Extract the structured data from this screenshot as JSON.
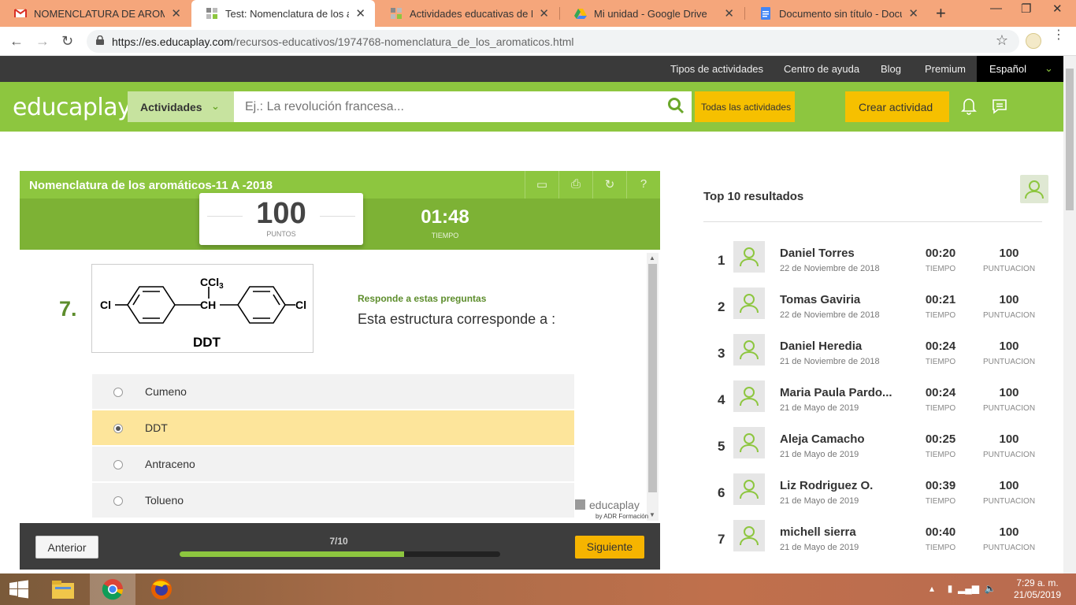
{
  "browser": {
    "tabs": [
      {
        "title": "NOMENCLATURA DE AROMATICOS",
        "icon": "gmail-icon"
      },
      {
        "title": "Test: Nomenclatura de los aromáticos",
        "icon": "educaplay-icon"
      },
      {
        "title": "Actividades educativas de Maria",
        "icon": "educaplay-icon"
      },
      {
        "title": "Mi unidad - Google Drive",
        "icon": "drive-icon"
      },
      {
        "title": "Documento sin título - Documentos",
        "icon": "docs-icon"
      }
    ],
    "url_host": "https://es.educaplay.com",
    "url_path": "/recursos-educativos/1974768-nomenclatura_de_los_aromaticos.html"
  },
  "topbar": {
    "links": [
      "Tipos de actividades",
      "Centro de ayuda",
      "Blog",
      "Premium"
    ],
    "language": "Español"
  },
  "header": {
    "logo": "educaplay",
    "activities_label": "Actividades",
    "search_placeholder": "Ej.: La revolución francesa...",
    "all_activities": "Todas las actividades",
    "create_activity": "Crear actividad"
  },
  "quiz": {
    "title": "Nomenclatura de los aromáticos-11 A -2018",
    "score": "100",
    "score_label": "PUNTOS",
    "time": "01:48",
    "time_label": "TIEMPO",
    "question_number": "7.",
    "prompt": "Responde a estas preguntas",
    "question": "Esta estructura corresponde a :",
    "image": {
      "label": "DDT",
      "top_group": "CCl",
      "top_group_sub": "3",
      "center": "CH",
      "left": "Cl",
      "right": "Cl"
    },
    "options": [
      {
        "label": "Cumeno",
        "selected": false
      },
      {
        "label": "DDT",
        "selected": true
      },
      {
        "label": "Antraceno",
        "selected": false
      },
      {
        "label": "Tolueno",
        "selected": false
      }
    ],
    "brand": "educaplay",
    "brand_sub": "by ADR Formación",
    "prev_label": "Anterior",
    "next_label": "Siguiente",
    "progress_text": "7/10",
    "progress_fraction": 0.7
  },
  "ranking": {
    "title": "Top 10 resultados",
    "time_label": "TIEMPO",
    "score_label": "PUNTUACION",
    "rows": [
      {
        "pos": "1",
        "name": "Daniel Torres",
        "date": "22 de Noviembre de 2018",
        "time": "00:20",
        "score": "100"
      },
      {
        "pos": "2",
        "name": "Tomas Gaviria",
        "date": "22 de Noviembre de 2018",
        "time": "00:21",
        "score": "100"
      },
      {
        "pos": "3",
        "name": "Daniel Heredia",
        "date": "21 de Noviembre de 2018",
        "time": "00:24",
        "score": "100"
      },
      {
        "pos": "4",
        "name": "Maria Paula Pardo...",
        "date": "21 de Mayo de 2019",
        "time": "00:24",
        "score": "100"
      },
      {
        "pos": "5",
        "name": "Aleja Camacho",
        "date": "21 de Mayo de 2019",
        "time": "00:25",
        "score": "100"
      },
      {
        "pos": "6",
        "name": "Liz Rodriguez O.",
        "date": "21 de Mayo de 2019",
        "time": "00:39",
        "score": "100"
      },
      {
        "pos": "7",
        "name": "michell sierra",
        "date": "21 de Mayo de 2019",
        "time": "00:40",
        "score": "100"
      }
    ]
  },
  "taskbar": {
    "time": "7:29 a. m.",
    "date": "21/05/2019"
  },
  "colors": {
    "brand_green": "#8dc63f",
    "dark_green": "#7db235",
    "accent_yellow": "#f6c000",
    "selected_option": "#fde59b"
  }
}
